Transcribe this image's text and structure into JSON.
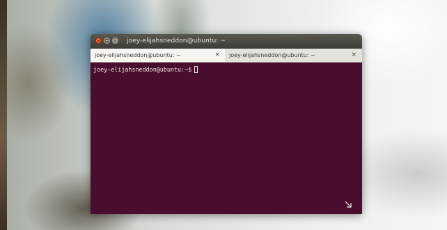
{
  "window": {
    "title": "joey-elijahsneddon@ubuntu: ~"
  },
  "tabs": [
    {
      "label": "joey-elijahsneddon@ubuntu: ~",
      "close_label": "×"
    },
    {
      "label": "joey-elijahsneddon@ubuntu: ~",
      "close_label": "×"
    }
  ],
  "terminal": {
    "prompt": "joey-elijahsneddon@ubuntu:~$",
    "background": "#490d2d",
    "foreground": "#ece8e4"
  },
  "colors": {
    "close_button": "#dd4814",
    "titlebar": "#3d3c37"
  },
  "icons": {
    "close": "close-icon",
    "minimize": "minimize-icon",
    "maximize": "maximize-icon",
    "resize": "resize-grip-icon"
  }
}
